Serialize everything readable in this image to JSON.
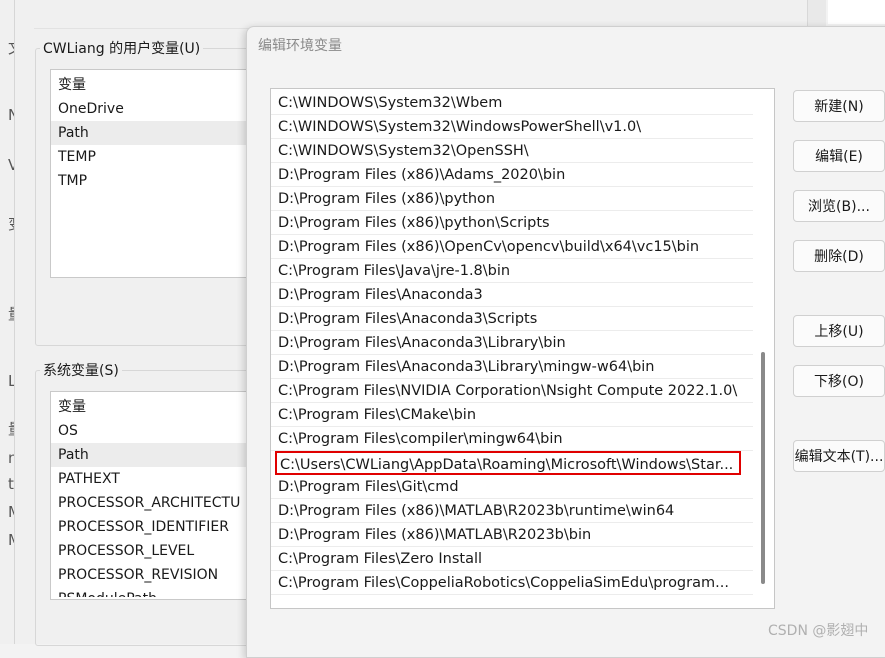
{
  "left_edge_glyphs": [
    "文",
    "N",
    "V",
    "变",
    "量",
    "Li",
    "量",
    "ne",
    "t",
    "M",
    "M"
  ],
  "user_vars": {
    "title": "CWLiang 的用户变量(U)",
    "header": "变量",
    "items": [
      "OneDrive",
      "Path",
      "TEMP",
      "TMP"
    ],
    "selected": "Path"
  },
  "system_vars": {
    "title": "系统变量(S)",
    "header": "变量",
    "items": [
      "OS",
      "Path",
      "PATHEXT",
      "PROCESSOR_ARCHITECTU",
      "PROCESSOR_IDENTIFIER",
      "PROCESSOR_LEVEL",
      "PROCESSOR_REVISION",
      "PSModulePath"
    ],
    "selected": "Path"
  },
  "edit_dialog": {
    "title": "编辑环境变量",
    "paths": [
      "C:\\WINDOWS\\System32\\Wbem",
      "C:\\WINDOWS\\System32\\WindowsPowerShell\\v1.0\\",
      "C:\\WINDOWS\\System32\\OpenSSH\\",
      "D:\\Program Files (x86)\\Adams_2020\\bin",
      "D:\\Program Files (x86)\\python",
      "D:\\Program Files (x86)\\python\\Scripts",
      "D:\\Program Files (x86)\\OpenCv\\opencv\\build\\x64\\vc15\\bin",
      "C:\\Program Files\\Java\\jre-1.8\\bin",
      "D:\\Program Files\\Anaconda3",
      "D:\\Program Files\\Anaconda3\\Scripts",
      "D:\\Program Files\\Anaconda3\\Library\\bin",
      "D:\\Program Files\\Anaconda3\\Library\\mingw-w64\\bin",
      "C:\\Program Files\\NVIDIA Corporation\\Nsight Compute 2022.1.0\\",
      "C:\\Program Files\\CMake\\bin",
      "C:\\Program Files\\compiler\\mingw64\\bin",
      "C:\\Users\\CWLiang\\AppData\\Roaming\\Microsoft\\Windows\\Star...",
      "D:\\Program Files\\Git\\cmd",
      "D:\\Program Files (x86)\\MATLAB\\R2023b\\runtime\\win64",
      "D:\\Program Files (x86)\\MATLAB\\R2023b\\bin",
      "C:\\Program Files\\Zero Install",
      "C:\\Program Files\\CoppeliaRobotics\\CoppeliaSimEdu\\program..."
    ],
    "highlighted_index": 15,
    "highlight_color": "#e00000",
    "buttons": {
      "new": "新建(N)",
      "edit": "编辑(E)",
      "browse": "浏览(B)...",
      "delete": "删除(D)",
      "move_up": "上移(U)",
      "move_down": "下移(O)",
      "edit_text": "编辑文本(T)..."
    }
  },
  "watermark": "CSDN @影翅中"
}
